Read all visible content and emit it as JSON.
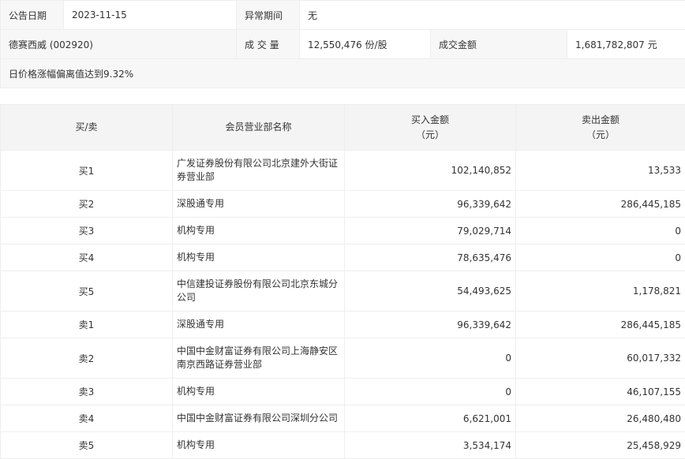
{
  "info": {
    "date_label": "公告日期",
    "date_value": "2023-11-15",
    "period_label": "异常期间",
    "period_value": "无",
    "stock": "德赛西威 (002920)",
    "volume_label": "成 交 量",
    "volume_value": "12,550,476 份/股",
    "amount_label": "成交金额",
    "amount_value": "1,681,782,807 元",
    "description": "日价格涨幅偏离值达到9.32%"
  },
  "table": {
    "headers": {
      "side": "买/卖",
      "name": "会员营业部名称",
      "buy_line1": "买入金额",
      "buy_line2": "（元）",
      "sell_line1": "卖出金额",
      "sell_line2": "（元）"
    },
    "rows": [
      {
        "side": "买1",
        "name": "广发证券股份有限公司北京建外大街证券营业部",
        "buy": "102,140,852",
        "sell": "13,533"
      },
      {
        "side": "买2",
        "name": "深股通专用",
        "buy": "96,339,642",
        "sell": "286,445,185"
      },
      {
        "side": "买3",
        "name": "机构专用",
        "buy": "79,029,714",
        "sell": "0"
      },
      {
        "side": "买4",
        "name": "机构专用",
        "buy": "78,635,476",
        "sell": "0"
      },
      {
        "side": "买5",
        "name": "中信建投证券股份有限公司北京东城分公司",
        "buy": "54,493,625",
        "sell": "1,178,821"
      },
      {
        "side": "卖1",
        "name": "深股通专用",
        "buy": "96,339,642",
        "sell": "286,445,185"
      },
      {
        "side": "卖2",
        "name": "中国中金财富证券有限公司上海静安区南京西路证券营业部",
        "buy": "0",
        "sell": "60,017,332"
      },
      {
        "side": "卖3",
        "name": "机构专用",
        "buy": "0",
        "sell": "46,107,155"
      },
      {
        "side": "卖4",
        "name": "中国中金财富证券有限公司深圳分公司",
        "buy": "6,621,001",
        "sell": "26,480,480"
      },
      {
        "side": "卖5",
        "name": "机构专用",
        "buy": "3,534,174",
        "sell": "25,458,929"
      }
    ]
  }
}
